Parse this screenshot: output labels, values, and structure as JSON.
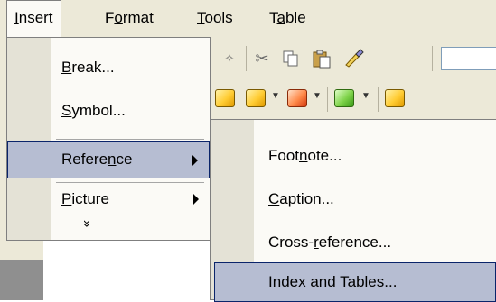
{
  "menubar": {
    "items": [
      {
        "pre": "",
        "key": "I",
        "post": "nsert"
      },
      {
        "pre": "F",
        "key": "o",
        "post": "rmat"
      },
      {
        "pre": "",
        "key": "T",
        "post": "ools"
      },
      {
        "pre": "T",
        "key": "a",
        "post": "ble"
      }
    ]
  },
  "insert_menu": {
    "items": [
      {
        "pre": "",
        "key": "B",
        "post": "reak..."
      },
      {
        "pre": "",
        "key": "S",
        "post": "ymbol..."
      },
      {
        "pre": "Refere",
        "key": "n",
        "post": "ce"
      },
      {
        "pre": "",
        "key": "P",
        "post": "icture"
      }
    ],
    "expand_glyph": "»"
  },
  "reference_submenu": {
    "items": [
      {
        "pre": "Foot",
        "key": "n",
        "post": "ote..."
      },
      {
        "pre": "",
        "key": "C",
        "post": "aption..."
      },
      {
        "pre": "Cross-",
        "key": "r",
        "post": "eference..."
      },
      {
        "pre": "In",
        "key": "d",
        "post": "ex and Tables..."
      }
    ]
  },
  "toolbar": {
    "icons": [
      "spellcheck-icon",
      "cut-icon",
      "copy-icon",
      "paste-icon",
      "format-painter-icon"
    ]
  },
  "colors": {
    "menu_background": "#fbfaf6",
    "highlight_fill": "#b6bdd2",
    "highlight_border": "#0a246a",
    "chrome": "#ece9d8"
  }
}
